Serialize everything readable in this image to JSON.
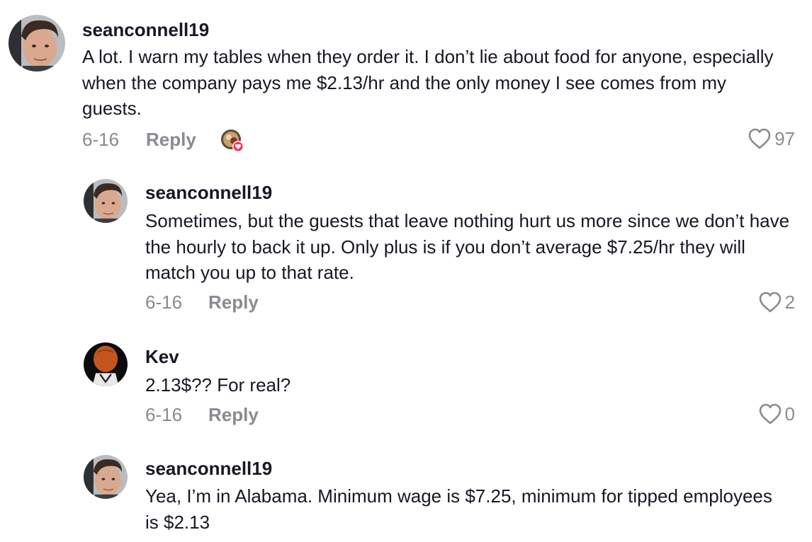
{
  "comments": [
    {
      "username": "seanconnell19",
      "text": "A lot. I warn my tables when they order it. I don’t lie about food for anyone, especially when the company pays me $2.13/hr and the only money I see comes from my guests.",
      "date": "6-16",
      "reply_label": "Reply",
      "likes": "97",
      "avatar_icon": "user-avatar"
    },
    {
      "username": "seanconnell19",
      "text": "Sometimes, but the guests that leave nothing hurt us more since we don’t have the hourly to back it up. Only plus is if you don’t average $7.25/hr they will match you up to that rate.",
      "date": "6-16",
      "reply_label": "Reply",
      "likes": "2",
      "avatar_icon": "user-avatar"
    },
    {
      "username": "Kev",
      "text": "2.13$?? For real?",
      "date": "6-16",
      "reply_label": "Reply",
      "likes": "0",
      "avatar_icon": "user-avatar"
    },
    {
      "username": "seanconnell19",
      "text": "Yea, I’m in Alabama. Minimum wage is $7.25, minimum for tipped employees is $2.13",
      "avatar_icon": "user-avatar"
    }
  ],
  "colors": {
    "text": "#161823",
    "muted": "#8a8b91",
    "like_badge": "#fe2c55"
  }
}
